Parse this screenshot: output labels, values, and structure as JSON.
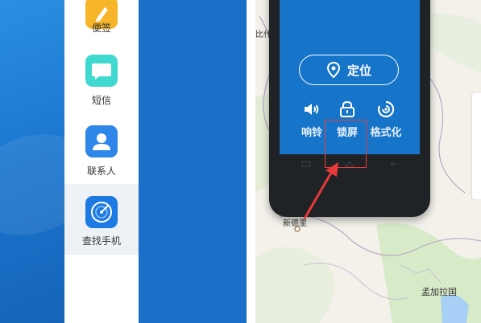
{
  "sidebar": {
    "items": [
      {
        "label": "便签",
        "icon": "note-icon",
        "color": "#f7b529"
      },
      {
        "label": "短信",
        "icon": "chat-bubble-icon",
        "color": "#3fd9d0"
      },
      {
        "label": "联系人",
        "icon": "person-icon",
        "color": "#2d86e8"
      },
      {
        "label": "查找手机",
        "icon": "radar-icon",
        "color": "#1d7ae3",
        "active": true
      }
    ]
  },
  "phone": {
    "locate_label": "定位",
    "actions": [
      {
        "label": "响铃",
        "icon": "speaker-icon"
      },
      {
        "label": "锁屏",
        "icon": "lock-icon"
      },
      {
        "label": "格式化",
        "icon": "format-icon"
      }
    ]
  },
  "map": {
    "labels": {
      "top_left": "比什",
      "mid": "新德里",
      "bottom": "孟加拉国"
    }
  },
  "colors": {
    "accent": "#1674c9",
    "highlight": "#e83a3a"
  }
}
